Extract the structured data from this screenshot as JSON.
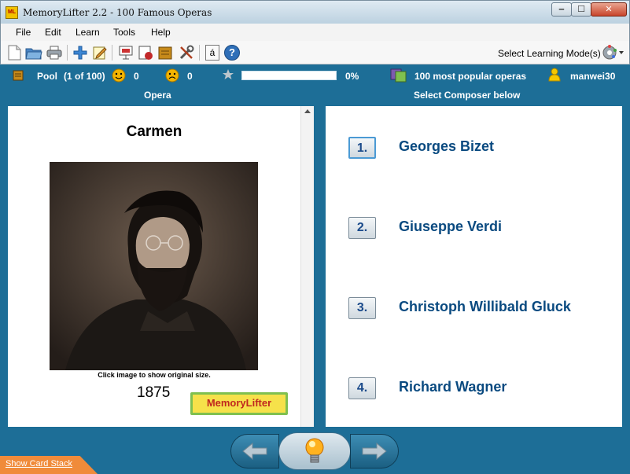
{
  "window": {
    "title": "MemoryLifter 2.2 - 100 Famous Operas",
    "app_icon_text": "ML",
    "minimize": "‒",
    "maximize": "☐",
    "close": "✕"
  },
  "menu": {
    "items": [
      {
        "label": "File"
      },
      {
        "label": "Edit"
      },
      {
        "label": "Learn"
      },
      {
        "label": "Tools"
      },
      {
        "label": "Help"
      }
    ]
  },
  "toolbar": {
    "icons": [
      "new-file-icon",
      "open-folder-icon",
      "print-icon",
      "add-card-icon",
      "edit-card-icon",
      "slideshow-icon",
      "statistics-icon",
      "card-box-icon",
      "tools-icon",
      "special-char-icon",
      "help-icon"
    ],
    "special_char_label": "á",
    "help_label": "?",
    "mode_label": "Select Learning Mode(s)"
  },
  "status": {
    "pool_label": "Pool",
    "pool_count": "(1 of 100)",
    "correct_count": "0",
    "wrong_count": "0",
    "progress_text": "0%",
    "progress_value": 0,
    "dictionary_name": "100 most popular operas",
    "user_name": "manwei30"
  },
  "headers": {
    "question": "Opera",
    "answer": "Select Composer below"
  },
  "card": {
    "title": "Carmen",
    "image_hint": "Click image to show original size.",
    "year": "1875",
    "logo_text": "MemoryLifter"
  },
  "answers": [
    {
      "number": "1.",
      "text": "Georges Bizet",
      "selected": true
    },
    {
      "number": "2.",
      "text": "Giuseppe Verdi",
      "selected": false
    },
    {
      "number": "3.",
      "text": "Christoph Willibald Gluck",
      "selected": false
    },
    {
      "number": "4.",
      "text": "Richard Wagner",
      "selected": false
    }
  ],
  "bottom": {
    "show_card_stack": "Show Card Stack"
  },
  "colors": {
    "accent": "#1d6e97",
    "answer_text": "#0a4a80",
    "card_stack_tab": "#f08b3a"
  }
}
